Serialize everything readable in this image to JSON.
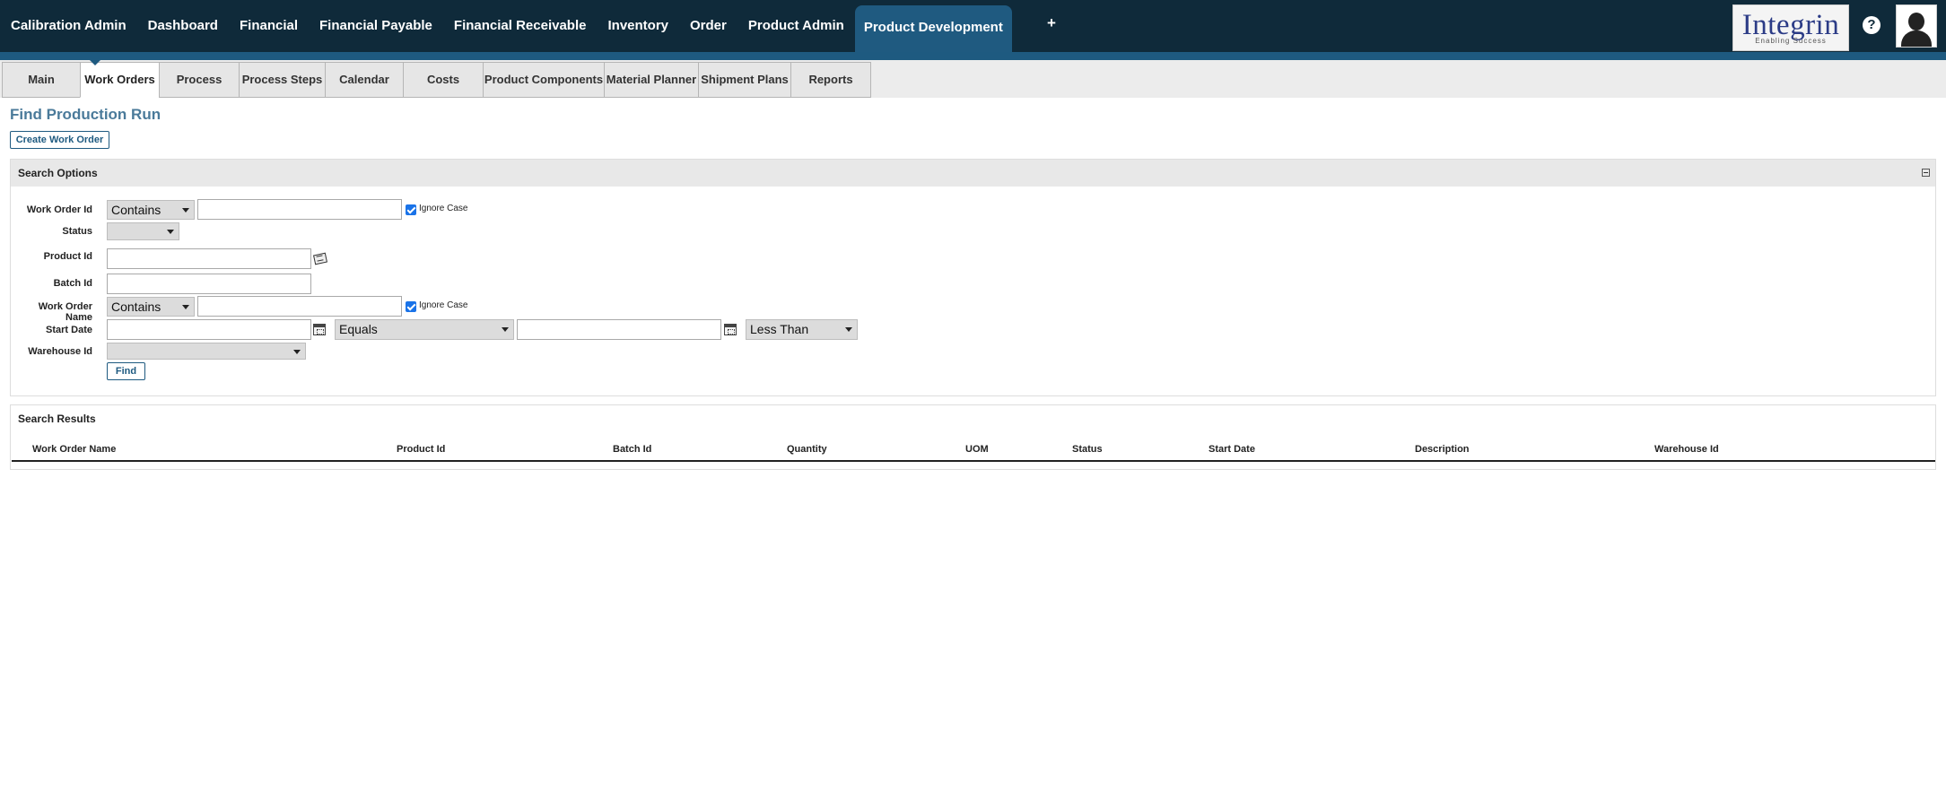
{
  "topnav": {
    "items": [
      {
        "label": "Calibration Admin"
      },
      {
        "label": "Dashboard"
      },
      {
        "label": "Financial"
      },
      {
        "label": "Financial Payable"
      },
      {
        "label": "Financial Receivable"
      },
      {
        "label": "Inventory"
      },
      {
        "label": "Order"
      },
      {
        "label": "Product Admin"
      },
      {
        "label": "Product Development"
      }
    ],
    "active": "Product Development",
    "plus_label": "+",
    "help_label": "?"
  },
  "logo": {
    "main": "Integrin",
    "sub": "Enabling Success"
  },
  "subtabs": {
    "items": [
      {
        "label": "Main"
      },
      {
        "label": "Work Orders"
      },
      {
        "label": "Process"
      },
      {
        "label": "Process Steps"
      },
      {
        "label": "Calendar"
      },
      {
        "label": "Costs"
      },
      {
        "label": "Product Components"
      },
      {
        "label": "Material Planner"
      },
      {
        "label": "Shipment Plans"
      },
      {
        "label": "Reports"
      }
    ],
    "active": "Work Orders"
  },
  "page": {
    "title": "Find Production Run",
    "create_button": "Create Work Order"
  },
  "search_options": {
    "header": "Search Options",
    "fields": {
      "work_order_id": {
        "label": "Work Order Id",
        "operator": "Contains",
        "value": "",
        "ignore_case": true,
        "ignore_case_label": "Ignore Case"
      },
      "status": {
        "label": "Status",
        "value": ""
      },
      "product_id": {
        "label": "Product Id",
        "value": ""
      },
      "batch_id": {
        "label": "Batch Id",
        "value": ""
      },
      "work_order_name": {
        "label": "Work Order Name",
        "operator": "Contains",
        "value": "",
        "ignore_case": true,
        "ignore_case_label": "Ignore Case"
      },
      "start_date": {
        "label": "Start Date",
        "from_value": "",
        "from_operator": "Equals",
        "to_value": "",
        "to_operator": "Less Than"
      },
      "warehouse_id": {
        "label": "Warehouse Id",
        "value": ""
      }
    },
    "find_button": "Find"
  },
  "search_results": {
    "header": "Search Results",
    "columns": [
      "Work Order Name",
      "Product Id",
      "Batch Id",
      "Quantity",
      "UOM",
      "Status",
      "Start Date",
      "Description",
      "Warehouse Id"
    ],
    "rows": []
  }
}
